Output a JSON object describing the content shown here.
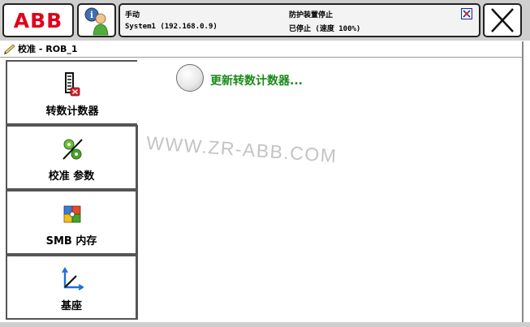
{
  "header": {
    "logo_text": "ABB",
    "status": {
      "mode": "手动",
      "system": "System1 (192.168.0.9)",
      "protection": "防护装置停止",
      "state": "已停止 (速度 100%)"
    }
  },
  "breadcrumb": {
    "text": "校准 - ROB_1"
  },
  "sidebar": {
    "items": [
      {
        "label": "转数计数器",
        "icon": "rev-counter-icon"
      },
      {
        "label": "校准 参数",
        "icon": "calibration-params-icon"
      },
      {
        "label": "SMB 内存",
        "icon": "smb-memory-icon"
      },
      {
        "label": "基座",
        "icon": "base-frame-icon"
      }
    ]
  },
  "main": {
    "option_label": "更新转数计数器..."
  },
  "watermark": "WWW.ZR-ABB.COM",
  "colors": {
    "logo_red": "#e2001a",
    "option_green": "#1a8a1a"
  }
}
